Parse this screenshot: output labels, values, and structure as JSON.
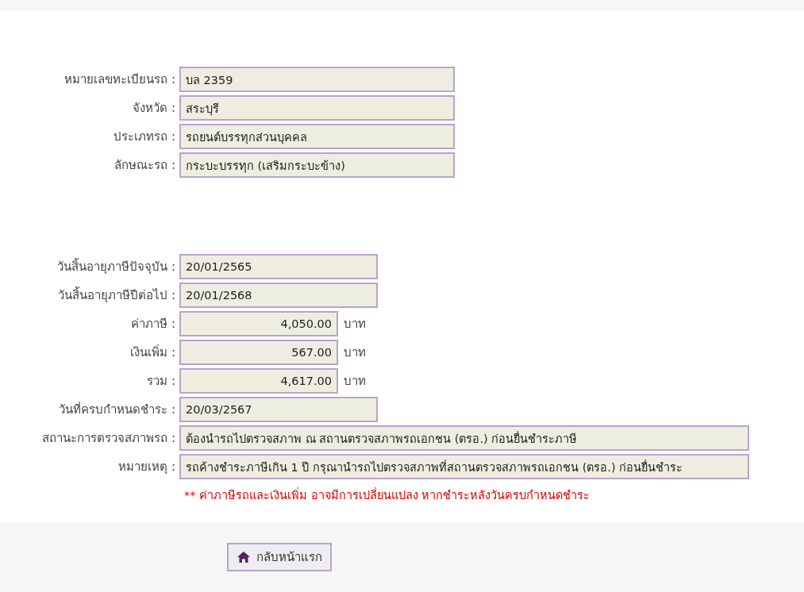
{
  "vehicle": [
    {
      "label": "หมายเลขทะเบียนรถ :",
      "value": "บล 2359"
    },
    {
      "label": "จังหวัด :",
      "value": "สระบุรี"
    },
    {
      "label": "ประเภทรถ :",
      "value": "รถยนต์บรรทุกส่วนบุคคล"
    },
    {
      "label": "ลักษณะรถ :",
      "value": "กระบะบรรทุก (เสริมกระบะข้าง)"
    }
  ],
  "tax": [
    {
      "label": "วันสิ้นอายุภาษีปัจจุบัน :",
      "value": "20/01/2565",
      "kind": "date"
    },
    {
      "label": "วันสิ้นอายุภาษีปีต่อไป :",
      "value": "20/01/2568",
      "kind": "date"
    },
    {
      "label": "ค่าภาษี :",
      "value": "4,050.00",
      "kind": "amount",
      "unit": "บาท"
    },
    {
      "label": "เงินเพิ่ม :",
      "value": "567.00",
      "kind": "amount",
      "unit": "บาท"
    },
    {
      "label": "รวม :",
      "value": "4,617.00",
      "kind": "amount",
      "unit": "บาท"
    },
    {
      "label": "วันที่ครบกำหนดชำระ :",
      "value": "20/03/2567",
      "kind": "date"
    },
    {
      "label": "สถานะการตรวจสภาพรถ :",
      "value": "ต้องนำรถไปตรวจสภาพ ณ สถานตรวจสภาพรถเอกชน (ตรอ.) ก่อนยื่นชำระภาษี",
      "kind": "wide"
    },
    {
      "label": "หมายเหตุ :",
      "value": "รถค้างชำระภาษีเกิน 1 ปี กรุณานำรถไปตรวจสภาพที่สถานตรวจสภาพรถเอกชน (ตรอ.) ก่อนยื่นชำระ",
      "kind": "wide"
    }
  ],
  "warning": "** ค่าภาษีรถและเงินเพิ่ม อาจมีการเปลี่ยนแปลง หากชำระหลังวันครบกำหนดชำระ",
  "home_button": "กลับหน้าแรก"
}
